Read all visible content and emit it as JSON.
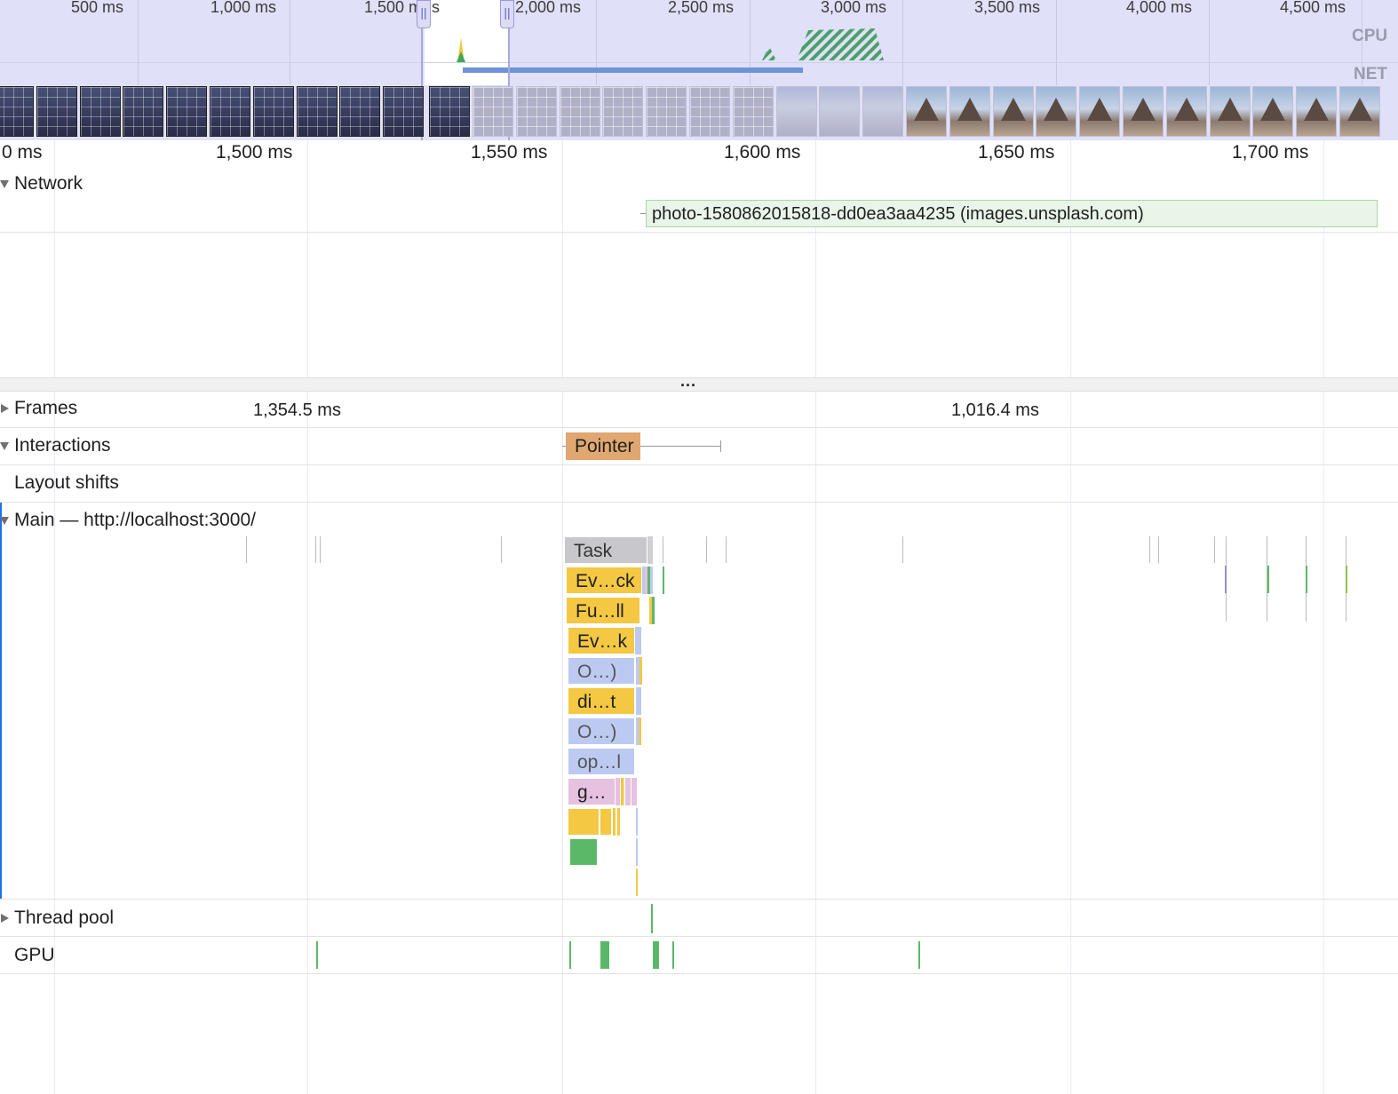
{
  "overview": {
    "ticks": [
      "500 ms",
      "1,000 ms",
      "1,500 ms",
      "s",
      "2,000 ms",
      "2,500 ms",
      "3,000 ms",
      "3,500 ms",
      "4,000 ms",
      "4,500 ms"
    ],
    "cpu_label": "CPU",
    "net_label": "NET",
    "handle_glyph": "||"
  },
  "ruler": {
    "ticks": [
      "0 ms",
      "1,500 ms",
      "1,550 ms",
      "1,600 ms",
      "1,650 ms",
      "1,700 ms"
    ]
  },
  "tracks": {
    "network": {
      "label": "Network",
      "request": "photo-1580862015818-dd0ea3aa4235 (images.unsplash.com)"
    },
    "splitter": "...",
    "frames": {
      "label": "Frames",
      "values": [
        "1,354.5 ms",
        "1,016.4 ms"
      ]
    },
    "interactions": {
      "label": "Interactions",
      "event": "Pointer"
    },
    "layout_shifts": {
      "label": "Layout shifts"
    },
    "main": {
      "label": "Main — http://localhost:3000/",
      "flame": [
        "Task",
        "Ev…ck",
        "Fu…ll",
        "Ev…k",
        "O…)",
        "di…t",
        "O…)",
        "op…l",
        "g…"
      ]
    },
    "thread_pool": {
      "label": "Thread pool"
    },
    "gpu": {
      "label": "GPU"
    }
  },
  "colors": {
    "overview_bg": "#e0e0f8",
    "task": "#c8c8cc",
    "scripting": "#f4c842",
    "system": "#bccaf2",
    "rendering": "#e6c1e0",
    "painting": "#5cb869",
    "interaction": "#e1a770",
    "network_request": "#e8f5e8"
  }
}
